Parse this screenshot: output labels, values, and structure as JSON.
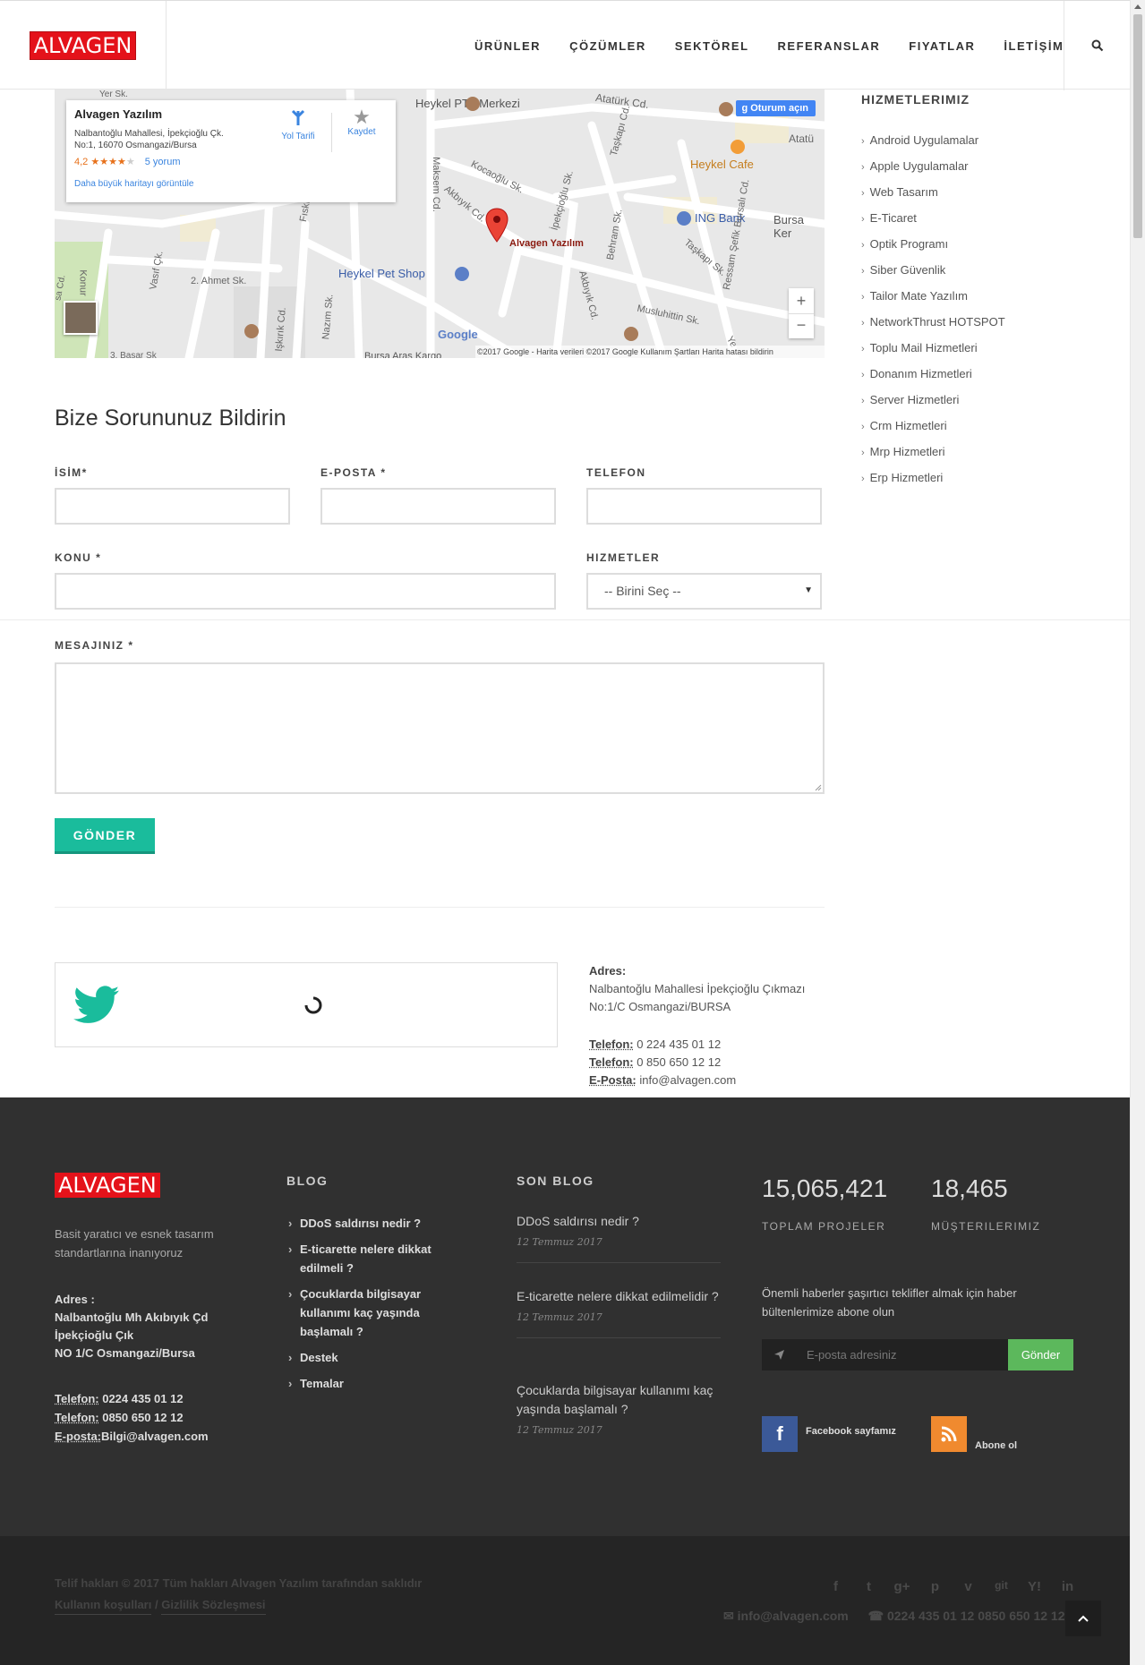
{
  "header": {
    "logo": "ALVAGEN",
    "nav": [
      "ÜRÜNLER",
      "ÇÖZÜMLER",
      "SEKTÖREL",
      "REFERANSLAR",
      "FIYATLAR",
      "İLETİŞİM"
    ]
  },
  "map": {
    "place_name": "Alvagen Yazılım",
    "address_line1": "Nalbantoğlu Mahallesi, İpekçioğlu Çk.",
    "address_line2": "No:1, 16070 Osmangazi/Bursa",
    "rating": "4,2",
    "stars": "★★★★",
    "reviews": "5 yorum",
    "larger_map": "Daha büyük haritayı görüntüle",
    "directions": "Yol Tarifi",
    "save": "Kaydet",
    "signin": "Oturum açın",
    "pin_label": "Alvagen Yazılım",
    "labels": {
      "ptt": "Heykel PTT Merkezi",
      "ataturk": "Atatürk Cd.",
      "ataturk2": "Atatü",
      "cafe": "Heykel Cafe",
      "bank": "ING Bank",
      "bursa_ker": "Bursa Ker",
      "kocaoglu": "Kocaoğlu Sk.",
      "akbiyik": "Akbıyık Cd.",
      "akbiyik2": "Akbıyık Cd.",
      "taskapi": "Taşkapı Cd.",
      "taskapi2": "Taşkapı Sk.",
      "ipekcioglu": "İpekçioğlu Sk.",
      "maksem": "Maksem Cd.",
      "behram": "Behram Sk.",
      "ressam": "Ressam Şefik Bursalı Cd.",
      "pet_shop": "Heykel Pet Shop",
      "ahmet": "2. Ahmet Sk.",
      "vasif": "Vasıf Çk.",
      "konur": "Konur",
      "fiski": "Fıskı",
      "nazim": "Nazım Sk.",
      "iskirik": "Işkırık Cd.",
      "muslu": "Musluhittin Sk.",
      "aras": "Bursa Aras Kargo",
      "basar": "3. Başar Sk",
      "sa_cd": "sa Cd.",
      "yer_sk": "Yer Sk.",
      "ye": "Ye"
    },
    "google": "Google",
    "footer": "©2017 Google - Harita verileri ©2017 Google   Kullanım Şartları    Harita hatası bildirin"
  },
  "form": {
    "title": "Bize Sorununuz Bildirin",
    "name_label": "İSİM*",
    "email_label": "E-POSTA *",
    "phone_label": "TELEFON",
    "subject_label": "KONU *",
    "services_label": "HIZMETLER",
    "services_value": "-- Birini Seç --",
    "message_label": "MESAJINIZ *",
    "submit": "GÖNDER"
  },
  "contact": {
    "address_label": "Adres:",
    "address": "Nalbantoğlu Mahallesi İpekçioğlu Çıkmazı No:1/C Osmangazi/BURSA",
    "phone_label": "Telefon:",
    "phone1": "0 224 435 01 12",
    "phone2": "0 850 650 12 12",
    "email_label": "E-Posta:",
    "email": "info@alvagen.com"
  },
  "sidebar": {
    "title": "HIZMETLERIMIZ",
    "items": [
      "Android Uygulamalar",
      "Apple Uygulamalar",
      "Web Tasarım",
      "E-Ticaret",
      "Optik Programı",
      "Siber Güvenlik",
      "Tailor Mate Yazılım",
      "NetworkThrust HOTSPOT",
      "Toplu Mail Hizmetleri",
      "Donanım Hizmetleri",
      "Server Hizmetleri",
      "Crm Hizmetleri",
      "Mrp Hizmetleri",
      "Erp Hizmetleri"
    ]
  },
  "footer": {
    "logo": "ALVAGEN",
    "tagline": "Basit yaratıcı ve esnek tasarım standartlarına inanıyoruz",
    "address_label": "Adres :",
    "address_line1": "Nalbantoğlu Mh Akıbıyık Çd",
    "address_line2": "İpekçioğlu Çık",
    "address_line3": "NO 1/C Osmangazi/Bursa",
    "phone_label": "Telefon:",
    "phone1": "0224 435 01 12",
    "phone2": "0850 650 12 12",
    "email_label": "E-posta:",
    "email": "Bilgi@alvagen.com",
    "blog_title": "BLOG",
    "blog": [
      "DDoS saldırısı nedir ?",
      "E-ticarette nelere dikkat edilmeli ?",
      "Çocuklarda bilgisayar kullanımı kaç yaşında başlamalı ?",
      "Destek",
      "Temalar"
    ],
    "recent_title": "SON BLOG",
    "recent": [
      {
        "title": "DDoS saldırısı nedir ?",
        "date": "12 Temmuz 2017"
      },
      {
        "title": "E-ticarette nelere dikkat edilmelidir ?",
        "date": "12 Temmuz 2017"
      },
      {
        "title": "Çocuklarda bilgisayar kullanımı kaç yaşında başlamalı ?",
        "date": "12 Temmuz 2017"
      }
    ],
    "stats": [
      {
        "value": "15,065,421",
        "label": "TOPLAM PROJELER"
      },
      {
        "value": "18,465",
        "label": "MÜŞTERILERIMIZ"
      }
    ],
    "newsletter_text": "Önemli haberler şaşırtıcı teklifler almak için haber bültenlerimize abone olun",
    "newsletter_placeholder": "E-posta adresiniz",
    "newsletter_button": "Gönder",
    "facebook_label": "Facebook sayfamız",
    "rss_label": "Abone ol"
  },
  "bottom": {
    "copyright": "Telif hakları © 2017 Tüm hakları Alvagen Yazılım tarafından saklıdır",
    "terms": "Kullanın koşulları",
    "privacy": "Gizlilik Sözleşmesi",
    "email": "info@alvagen.com",
    "phones": "0224 435 01 12   0850 650 12 12"
  },
  "colors": {
    "brand_red": "#e4121a",
    "accent_teal": "#1abc9c",
    "footer_bg": "#303030",
    "newsletter_green": "#5cb85c"
  }
}
